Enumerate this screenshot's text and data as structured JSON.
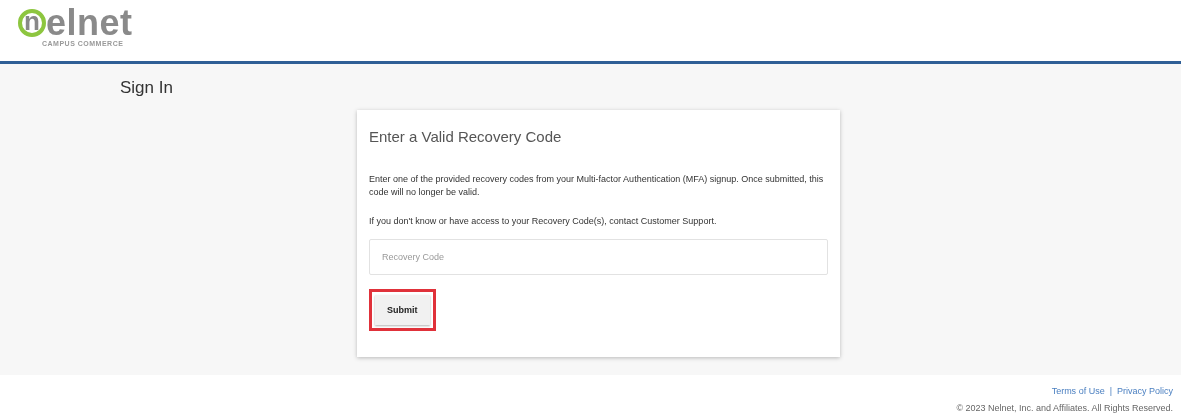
{
  "logo": {
    "mark": "n",
    "word": "elnet",
    "tagline": "CAMPUS COMMERCE"
  },
  "page_title": "Sign In",
  "card": {
    "title": "Enter a Valid Recovery Code",
    "paragraphs": [
      "Enter one of the provided recovery codes from your Multi-factor Authentication (MFA) signup. Once submitted, this code will no longer be valid.",
      "If you don't know or have access to your Recovery Code(s), contact Customer Support."
    ],
    "field": {
      "placeholder": "Recovery Code"
    },
    "button": {
      "label": "Submit",
      "highlighted": true
    }
  },
  "footer": {
    "links": [
      "Terms of Use",
      "Privacy Policy"
    ],
    "separator": "|",
    "copyright": "© 2023 Nelnet, Inc. and Affiliates. All Rights Reserved."
  }
}
